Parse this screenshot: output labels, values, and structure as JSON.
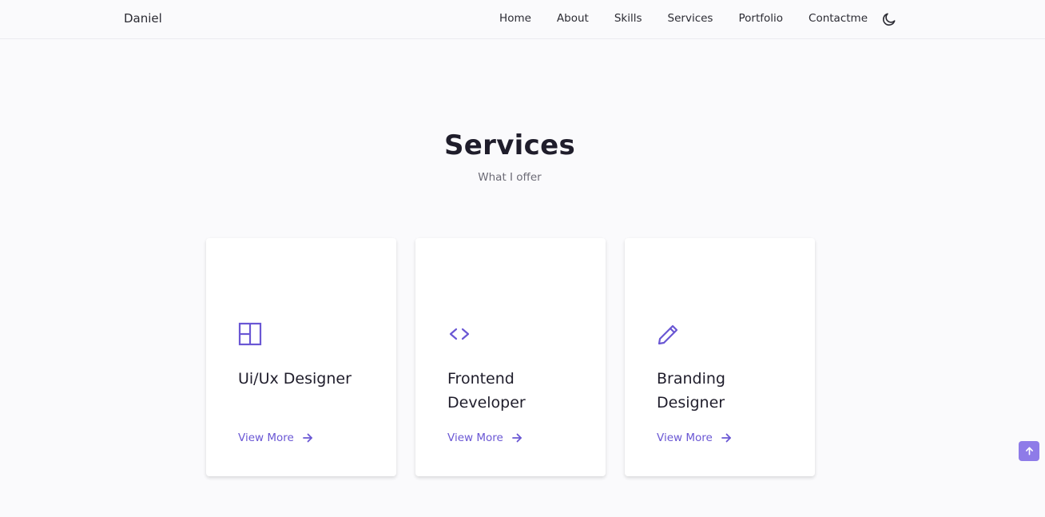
{
  "header": {
    "logo": "Daniel",
    "nav": [
      {
        "label": "Home"
      },
      {
        "label": "About"
      },
      {
        "label": "Skills"
      },
      {
        "label": "Services"
      },
      {
        "label": "Portfolio"
      },
      {
        "label": "Contactme"
      }
    ],
    "theme_icon": "moon-icon"
  },
  "section": {
    "title": "Services",
    "subtitle": "What I offer"
  },
  "cards": [
    {
      "icon": "layout-icon",
      "title": "Ui/Ux Designer",
      "link": "View More"
    },
    {
      "icon": "code-icon",
      "title": "Frontend Developer",
      "link": "View More"
    },
    {
      "icon": "pencil-icon",
      "title": "Branding Designer",
      "link": "View More"
    }
  ],
  "scroll_up_icon": "arrow-up-icon",
  "colors": {
    "accent": "#6a57d4",
    "scroll_button": "#8e7be8",
    "background": "#fafafc"
  }
}
